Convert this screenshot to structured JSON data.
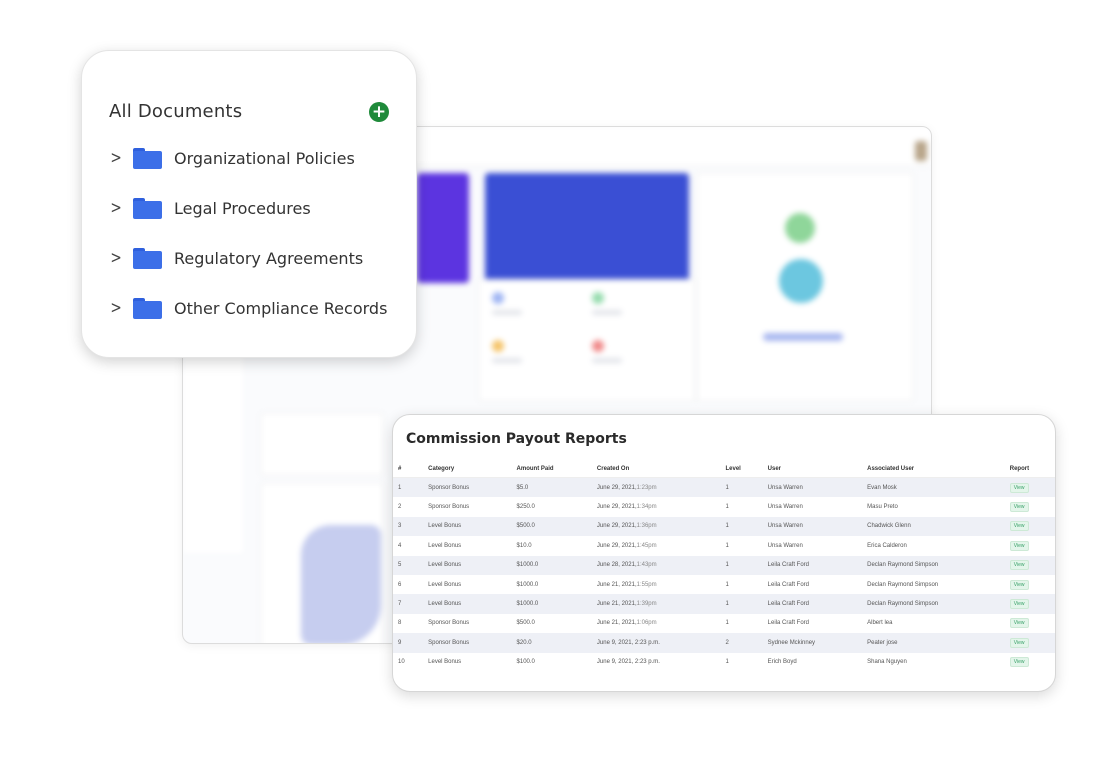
{
  "documents": {
    "title": "All Documents",
    "add_icon": "plus-circle-icon",
    "add_label": "+",
    "folders": [
      {
        "label": "Organizational Policies"
      },
      {
        "label": "Legal Procedures"
      },
      {
        "label": "Regulatory Agreements"
      },
      {
        "label": "Other Compliance Records"
      }
    ],
    "chevron": ">",
    "accent_color": "#1f8a3a",
    "folder_color": "#3c6fe8"
  },
  "report": {
    "title": "Commission Payout Reports",
    "columns": [
      "#",
      "Category",
      "Amount Paid",
      "Created On",
      "Level",
      "User",
      "Associated User",
      "Report"
    ],
    "view_label": "View",
    "rows": [
      {
        "n": "1",
        "category": "Sponsor Bonus",
        "amount": "$5.0",
        "date": "June 29, 2021,",
        "time": "1:23pm",
        "level": "1",
        "user": "Unsa Warren",
        "assoc": "Evan Mosk"
      },
      {
        "n": "2",
        "category": "Sponsor Bonus",
        "amount": "$250.0",
        "date": "June 29, 2021,",
        "time": "1:34pm",
        "level": "1",
        "user": "Unsa Warren",
        "assoc": "Masu Preto"
      },
      {
        "n": "3",
        "category": "Level Bonus",
        "amount": "$500.0",
        "date": "June 29, 2021,",
        "time": "1:36pm",
        "level": "1",
        "user": "Unsa Warren",
        "assoc": "Chadwick Glenn"
      },
      {
        "n": "4",
        "category": "Level Bonus",
        "amount": "$10.0",
        "date": "June 29, 2021,",
        "time": "1:45pm",
        "level": "1",
        "user": "Unsa Warren",
        "assoc": "Erica Calderon"
      },
      {
        "n": "5",
        "category": "Level Bonus",
        "amount": "$1000.0",
        "date": "June 28, 2021,",
        "time": "1:43pm",
        "level": "1",
        "user": "Leila Craft Ford",
        "assoc": "Declan Raymond Simpson"
      },
      {
        "n": "6",
        "category": "Level Bonus",
        "amount": "$1000.0",
        "date": "June 21, 2021,",
        "time": "1:55pm",
        "level": "1",
        "user": "Leila Craft Ford",
        "assoc": "Declan Raymond Simpson"
      },
      {
        "n": "7",
        "category": "Level Bonus",
        "amount": "$1000.0",
        "date": "June 21, 2021,",
        "time": "1:39pm",
        "level": "1",
        "user": "Leila Craft Ford",
        "assoc": "Declan Raymond Simpson"
      },
      {
        "n": "8",
        "category": "Sponsor Bonus",
        "amount": "$500.0",
        "date": "June 21, 2021,",
        "time": "1:06pm",
        "level": "1",
        "user": "Leila Craft Ford",
        "assoc": "Albert lea"
      },
      {
        "n": "9",
        "category": "Sponsor Bonus",
        "amount": "$20.0",
        "date": "June 9, 2021, 2:23 p.m.",
        "time": "",
        "level": "2",
        "user": "Sydnee Mckinney",
        "assoc": "Peater jose"
      },
      {
        "n": "10",
        "category": "Level Bonus",
        "amount": "$100.0",
        "date": "June 9, 2021, 2:23 p.m.",
        "time": "",
        "level": "1",
        "user": "Erich Boyd",
        "assoc": "Shana Nguyen"
      }
    ]
  }
}
